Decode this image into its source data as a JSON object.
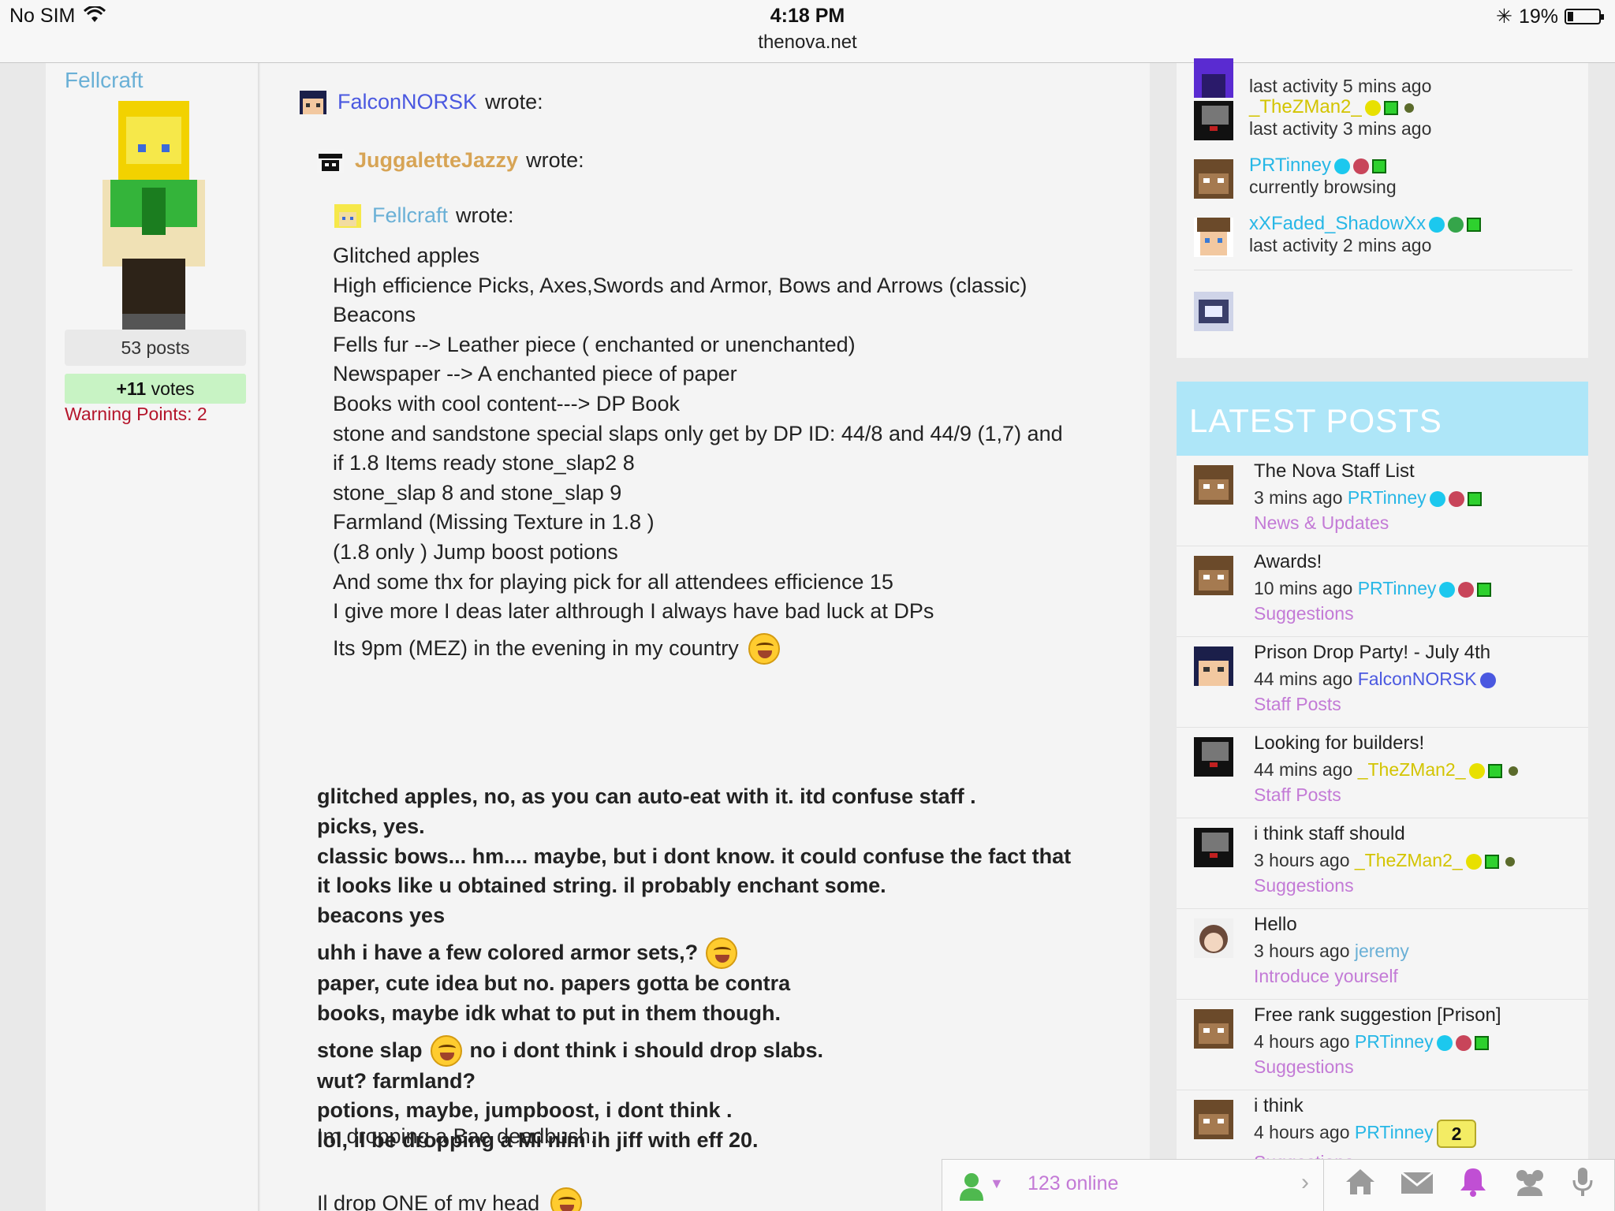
{
  "status_bar": {
    "carrier": "No SIM",
    "time": "4:18 PM",
    "url": "thenova.net",
    "battery": "19%",
    "battery_level": 0.19
  },
  "user": {
    "name": "Fellcraft",
    "posts": "53 posts",
    "votes_count": "+11",
    "votes_label": " votes",
    "warning": "Warning Points: 2"
  },
  "post": {
    "quote1": {
      "author": "FalconNORSK",
      "wrote": "wrote:"
    },
    "quote2": {
      "author": "JuggaletteJazzy",
      "wrote": "wrote:"
    },
    "quote3": {
      "author": "Fellcraft",
      "wrote": "wrote:",
      "lines": [
        "Glitched apples",
        "High efficience Picks, Axes,Swords and Armor, Bows and Arrows (classic)",
        "Beacons",
        "Fells fur --> Leather piece ( enchanted or unenchanted)",
        "Newspaper --> A enchanted piece of paper",
        "Books with cool content---> DP Book",
        "stone and sandstone special slaps only get by DP ID: 44/8 and 44/9 (1,7) and",
        "if 1.8 Items ready stone_slap2 8",
        "stone_slap 8 and stone_slap 9",
        "Farmland (Missing Texture in 1.8 )",
        "(1.8 only ) Jump boost potions",
        "And some thx for playing pick for all attendees efficience 15",
        "I give more I deas later althrough I always have bad luck at DPs"
      ],
      "last_line": "Its 9pm (MEZ) in the evening in my country"
    },
    "reply": {
      "l1": "glitched apples, no, as you can auto-eat with it. itd confuse staff .",
      "l2": "picks, yes.",
      "l3": "classic bows... hm.... maybe, but i dont know. it could confuse the fact that",
      "l4": "it looks like u obtained string. il probably enchant some.",
      "l5": "beacons yes",
      "l6": "uhh i have a few colored armor sets,?",
      "l7": "paper, cute idea but no. papers gotta be contra",
      "l8": "books, maybe idk what to put in them though.",
      "l9a": "stone slap",
      "l9b": "no i dont think i should drop slabs.",
      "l10": "wut? farmland?",
      "l11": "potions, maybe, jumpboost, i dont think .",
      "l12": "lol, il be dropping a Mi nim ih jiff with eff 20."
    },
    "after1": "Im dropping a Bae deadbush.",
    "after2": "Il drop ONE of my head"
  },
  "members": [
    {
      "name": "",
      "status": "last activity 5 mins ago"
    },
    {
      "name": "_TheZMan2_",
      "status": "last activity 3 mins ago"
    },
    {
      "name": "PRTinney",
      "status": "currently browsing"
    },
    {
      "name": "xXFaded_ShadowXx",
      "status": "last activity 2 mins ago"
    }
  ],
  "latest_posts": {
    "heading": "LATEST POSTS",
    "items": [
      {
        "title": "The Nova Staff List",
        "time": "3 mins ago",
        "author": "PRTinney",
        "category": "News & Updates"
      },
      {
        "title": "Awards!",
        "time": "10 mins ago",
        "author": "PRTinney",
        "category": "Suggestions"
      },
      {
        "title": "Prison Drop Party! - July 4th",
        "time": "44 mins ago",
        "author": "FalconNORSK",
        "category": "Staff Posts"
      },
      {
        "title": "Looking for builders!",
        "time": "44 mins ago",
        "author": "_TheZMan2_",
        "category": "Staff Posts"
      },
      {
        "title": "i think staff should",
        "time": "3 hours ago",
        "author": "_TheZMan2_",
        "category": "Suggestions"
      },
      {
        "title": "Hello",
        "time": "3 hours ago",
        "author": "jeremy",
        "category": "Introduce yourself"
      },
      {
        "title": "Free rank suggestion [Prison]",
        "time": "4 hours ago",
        "author": "PRTinney",
        "category": "Suggestions"
      },
      {
        "title": "i think",
        "time": "4 hours ago",
        "author": "PRTinney",
        "category": "Suggestions"
      }
    ]
  },
  "bottom_bar": {
    "online": "123 online",
    "notification_count": "2"
  },
  "colors": {
    "author_blue": "#4a58e0",
    "author_cyan": "#27b7e6",
    "author_yellow": "#d3c400",
    "author_gold": "#d7a455",
    "category_purple": "#c37ad6",
    "header_band": "#aee6f8"
  }
}
